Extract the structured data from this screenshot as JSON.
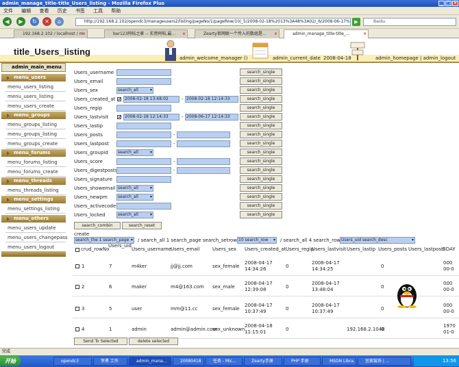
{
  "window": {
    "title": "admin_manage_title-title_Users_listing - Mozilla Firefox Plus"
  },
  "menubar": [
    "文件",
    "编辑",
    "查看",
    "历史",
    "书签",
    "工具",
    "帮助"
  ],
  "nav": {
    "url": "http://192.168.2.102/opendc3/manageusers2/listing/pageNo/1/pageRow/10/_5/2008-02-18%2013%3A48%3A02/_6/2008-06-17%2012%3A14%3A33",
    "search_placeholder": "Baidu"
  },
  "tabs": [
    {
      "label": "192.168.2.102 / localhost / m"
    },
    {
      "label": "bar123阿帖之家 -- 实用阿帖,最..."
    },
    {
      "label": "Zearty官网联一个传入的数组是..."
    },
    {
      "label": "admin_manage_title-title_..."
    }
  ],
  "header": {
    "title": "title_Users_listing",
    "welcome": "admin_welcome_manager ()",
    "current_date_label": "admin_current_date",
    "current_date": "2008-04-18",
    "links": "admin_homepage | admin_logout"
  },
  "sidebar": {
    "main": "admin_main_menu",
    "sections": [
      {
        "title": "menu_users",
        "items": [
          "menu_users_listing",
          "menu_users_listing",
          "menu_users_create"
        ]
      },
      {
        "title": "menu_groups",
        "items": [
          "menu_groups_listing",
          "menu_groups_listing",
          "menu_groups_create"
        ]
      },
      {
        "title": "menu_forums",
        "items": [
          "menu_forums_listing",
          "menu_forums_create"
        ]
      },
      {
        "title": "menu_threads",
        "items": [
          "menu_threads_listing"
        ]
      },
      {
        "title": "menu_settings",
        "items": [
          "menu_settings_listing"
        ]
      },
      {
        "title": "menu_others",
        "items": [
          "menu_users_update",
          "menu_users_changepass",
          "menu_users_logout"
        ]
      }
    ]
  },
  "form": {
    "fields": [
      {
        "label": "Users_username",
        "kind": "text"
      },
      {
        "label": "Users_email",
        "kind": "text"
      },
      {
        "label": "Users_sex",
        "kind": "select",
        "value": "search_all"
      },
      {
        "label": "Users_created_at",
        "kind": "daterange",
        "checked": "✔",
        "from": "2008-02-18 13:48:02",
        "to": "2008-02-18 12:14:33"
      },
      {
        "label": "Users_regip",
        "kind": "text"
      },
      {
        "label": "Users_lastvisit",
        "kind": "daterange",
        "checked": "✔",
        "from": "2008-02-18 12:14:33",
        "to": "2008-06-17 12:14:33"
      },
      {
        "label": "Users_lastip",
        "kind": "text"
      },
      {
        "label": "Users_posts",
        "kind": "range"
      },
      {
        "label": "Users_lastpost",
        "kind": "range"
      },
      {
        "label": "Users_groupid",
        "kind": "select",
        "value": "search_all"
      },
      {
        "label": "Users_score",
        "kind": "range"
      },
      {
        "label": "Users_digestposts",
        "kind": "range"
      },
      {
        "label": "Users_signature",
        "kind": "text"
      },
      {
        "label": "Users_showemail",
        "kind": "select",
        "value": "search_all"
      },
      {
        "label": "Users_newpm",
        "kind": "select",
        "value": "search_all"
      },
      {
        "label": "Users_activecode",
        "kind": "text"
      },
      {
        "label": "Users_locked",
        "kind": "select",
        "value": "search_all"
      }
    ],
    "search_single": "search_single",
    "search_combin": "search_combin",
    "search_reset": "search_reset"
  },
  "create_label": "create",
  "pager": {
    "page_select": "search_the 1 search_page",
    "text1": "/ search_all 1 search_page search_setrow",
    "row_select": "10 search_row",
    "text2": "/ search_all 4 search_row",
    "order_select": "Users_uid search_desc"
  },
  "table": {
    "headers": [
      "crud_rowNo",
      "Users_uid",
      "Users_username",
      "Users_email",
      "Users_sex",
      "Users_created_at",
      "Users_regip",
      "Users_lastvisit",
      "Users_lastip",
      "Users_posts",
      "Users_lastpost",
      "BDAY"
    ],
    "rows": [
      {
        "no": "1",
        "uid": "7",
        "username": "m4ker",
        "email": "jj@jj.com",
        "sex": "sex_female",
        "created_d": "2008-04-17",
        "created_t": "14:34:26",
        "regip": "0",
        "lastvisit_d": "2008-04-17",
        "lastvisit_t": "14:34:25",
        "lastip": "",
        "posts": "0",
        "lastpost": "",
        "bday_d": "000",
        "bday_t": "00-0"
      },
      {
        "no": "2",
        "uid": "6",
        "username": "maker",
        "email": "m4@163.com",
        "sex": "sex_male",
        "created_d": "2008-04-17",
        "created_t": "12:39:08",
        "regip": "0",
        "lastvisit_d": "2008-04-17",
        "lastvisit_t": "13:48:04",
        "lastip": "",
        "posts": "0",
        "lastpost": "",
        "bday_d": "000",
        "bday_t": "00-0"
      },
      {
        "no": "3",
        "uid": "5",
        "username": "user",
        "email": "mm@11.cc",
        "sex": "sex_female",
        "created_d": "2008-04-17",
        "created_t": "10:37:49",
        "regip": "0",
        "lastvisit_d": "2008-04-17",
        "lastvisit_t": "10:37:49",
        "lastip": "",
        "posts": "0",
        "lastpost": "",
        "bday_d": "000",
        "bday_t": "00-0"
      },
      {
        "no": "4",
        "uid": "1",
        "username": "admin",
        "email": "admin@admin.com",
        "sex": "sex_unknown",
        "created_d": "2008-04-18",
        "created_t": "11:15:01",
        "regip": "0",
        "lastvisit_d": "",
        "lastvisit_t": "",
        "lastip": "192.168.2.1040",
        "posts": "0",
        "lastpost": "",
        "bday_d": "1970",
        "bday_t": "01-0"
      }
    ],
    "send_selected": "Send To Selected",
    "delete_selected": "delete selected"
  },
  "status": "完成",
  "taskbar": {
    "start": "开始",
    "tasks": [
      "opendc3",
      "李勇 工作",
      "admin_mana...",
      "20080418",
      "任务 - Mic...",
      "Zearty手册",
      "PHP 手册",
      "MSDN Libra...",
      "宜家装饰 | ..."
    ],
    "time": "13:56"
  },
  "colors": {
    "accent": "#9a7c3a",
    "input_bg": "#b9cef0",
    "header_band": "#fbeeb6"
  }
}
